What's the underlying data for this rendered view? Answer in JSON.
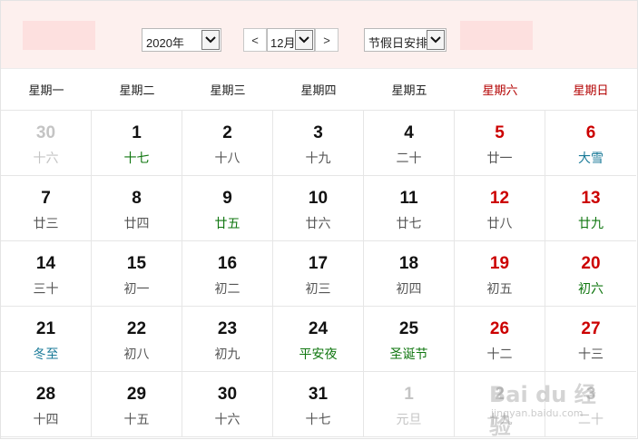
{
  "header": {
    "year_select": "2020年",
    "prev_label": "<",
    "month_select": "12月",
    "next_label": ">",
    "holiday_select": "节假日安排"
  },
  "weekdays": [
    {
      "label": "星期一",
      "weekend": false
    },
    {
      "label": "星期二",
      "weekend": false
    },
    {
      "label": "星期三",
      "weekend": false
    },
    {
      "label": "星期四",
      "weekend": false
    },
    {
      "label": "星期五",
      "weekend": false
    },
    {
      "label": "星期六",
      "weekend": true
    },
    {
      "label": "星期日",
      "weekend": true
    }
  ],
  "days": [
    {
      "num": "30",
      "lunar": "十六",
      "other": true
    },
    {
      "num": "1",
      "lunar": "十七",
      "fest": "green"
    },
    {
      "num": "2",
      "lunar": "十八"
    },
    {
      "num": "3",
      "lunar": "十九"
    },
    {
      "num": "4",
      "lunar": "二十"
    },
    {
      "num": "5",
      "lunar": "廿一",
      "weekend": true
    },
    {
      "num": "6",
      "lunar": "大雪",
      "weekend": true,
      "fest": "blue"
    },
    {
      "num": "7",
      "lunar": "廿三"
    },
    {
      "num": "8",
      "lunar": "廿四"
    },
    {
      "num": "9",
      "lunar": "廿五",
      "fest": "green"
    },
    {
      "num": "10",
      "lunar": "廿六"
    },
    {
      "num": "11",
      "lunar": "廿七"
    },
    {
      "num": "12",
      "lunar": "廿八",
      "weekend": true
    },
    {
      "num": "13",
      "lunar": "廿九",
      "weekend": true,
      "fest": "green"
    },
    {
      "num": "14",
      "lunar": "三十"
    },
    {
      "num": "15",
      "lunar": "初一"
    },
    {
      "num": "16",
      "lunar": "初二"
    },
    {
      "num": "17",
      "lunar": "初三"
    },
    {
      "num": "18",
      "lunar": "初四"
    },
    {
      "num": "19",
      "lunar": "初五",
      "weekend": true
    },
    {
      "num": "20",
      "lunar": "初六",
      "weekend": true,
      "fest": "green"
    },
    {
      "num": "21",
      "lunar": "冬至",
      "fest": "blue"
    },
    {
      "num": "22",
      "lunar": "初八"
    },
    {
      "num": "23",
      "lunar": "初九"
    },
    {
      "num": "24",
      "lunar": "平安夜",
      "fest": "green"
    },
    {
      "num": "25",
      "lunar": "圣诞节",
      "fest": "green"
    },
    {
      "num": "26",
      "lunar": "十二",
      "weekend": true
    },
    {
      "num": "27",
      "lunar": "十三",
      "weekend": true
    },
    {
      "num": "28",
      "lunar": "十四"
    },
    {
      "num": "29",
      "lunar": "十五"
    },
    {
      "num": "30",
      "lunar": "十六"
    },
    {
      "num": "31",
      "lunar": "十七"
    },
    {
      "num": "1",
      "lunar": "元旦",
      "other": true
    },
    {
      "num": "2",
      "lunar": "十九",
      "other": true
    },
    {
      "num": "3",
      "lunar": "二十",
      "other": true
    }
  ],
  "watermark": {
    "text": "Bai du 经验",
    "url": "jingyan.baidu.com"
  },
  "colors": {
    "header_bg": "#fdf0ee",
    "weekend_red": "#cc0000",
    "festival_green": "#117711",
    "solar_term_blue": "#1a7a98"
  }
}
